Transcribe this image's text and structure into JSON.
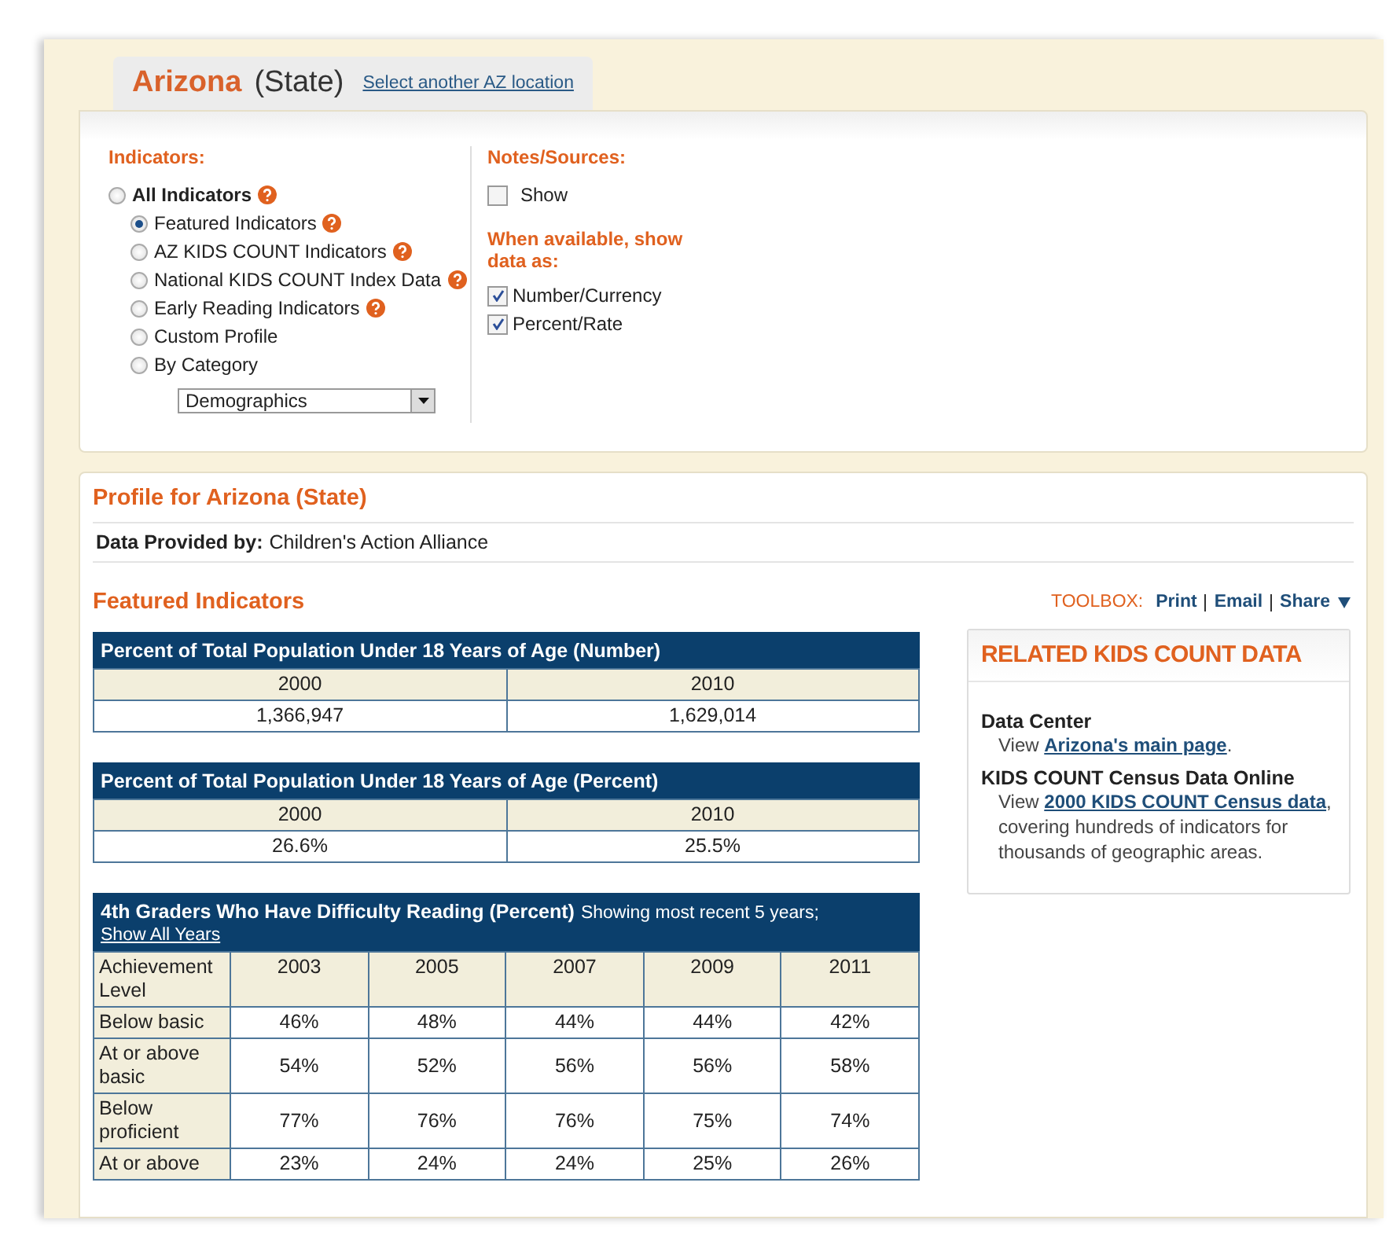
{
  "location_tab": {
    "name": "Arizona",
    "type": "(State)",
    "link": "Select another AZ location"
  },
  "options": {
    "indicators_label": "Indicators:",
    "indicators": [
      {
        "label": "All Indicators",
        "selected": false,
        "help": true,
        "children": [
          {
            "label": "Featured Indicators",
            "selected": true,
            "help": true
          },
          {
            "label": "AZ KIDS COUNT Indicators",
            "selected": false,
            "help": true
          },
          {
            "label": "National KIDS COUNT Index Data",
            "selected": false,
            "help": true
          },
          {
            "label": "Early Reading Indicators",
            "selected": false,
            "help": true
          },
          {
            "label": "Custom Profile",
            "selected": false,
            "help": false
          },
          {
            "label": "By Category",
            "selected": false,
            "help": false
          }
        ]
      }
    ],
    "category_select": {
      "value": "Demographics"
    },
    "notes_label": "Notes/Sources:",
    "notes_show": {
      "label": "Show",
      "checked": false
    },
    "display_label": "When available, show data as:",
    "display_options": [
      {
        "label": "Number/Currency",
        "checked": true
      },
      {
        "label": "Percent/Rate",
        "checked": true
      }
    ]
  },
  "profile": {
    "title": "Profile for Arizona (State)",
    "provider_label": "Data Provided by:",
    "provider": "Children's Action Alliance",
    "section_title": "Featured Indicators",
    "toolbox": {
      "label": "TOOLBOX:",
      "links": [
        "Print",
        "Email",
        "Share"
      ]
    },
    "tables": [
      {
        "title": "Percent of Total Population Under 18 Years of Age (Number)",
        "columns": [
          "2000",
          "2010"
        ],
        "rows": [
          [
            "1,366,947",
            "1,629,014"
          ]
        ]
      },
      {
        "title": "Percent of Total Population Under 18 Years of Age (Percent)",
        "columns": [
          "2000",
          "2010"
        ],
        "rows": [
          [
            "26.6%",
            "25.5%"
          ]
        ]
      },
      {
        "title": "4th Graders Who Have Difficulty Reading (Percent)",
        "note": "Showing most recent 5 years;",
        "link": "Show All Years",
        "columns": [
          "Achievement Level",
          "2003",
          "2005",
          "2007",
          "2009",
          "2011"
        ],
        "rows": [
          [
            "Below basic",
            "46%",
            "48%",
            "44%",
            "44%",
            "42%"
          ],
          [
            "At or above basic",
            "54%",
            "52%",
            "56%",
            "56%",
            "58%"
          ],
          [
            "Below proficient",
            "77%",
            "76%",
            "76%",
            "75%",
            "74%"
          ],
          [
            "At or above",
            "23%",
            "24%",
            "24%",
            "25%",
            "26%"
          ]
        ]
      }
    ]
  },
  "related": {
    "title": "RELATED KIDS COUNT DATA",
    "sections": [
      {
        "heading": "Data Center",
        "prefix": "View",
        "link": "Arizona's main page",
        "suffix": "."
      },
      {
        "heading": "KIDS COUNT Census Data Online",
        "prefix": "View",
        "link": "2000 KIDS COUNT Census data",
        "suffix": ", covering hundreds of indicators for thousands of geographic areas."
      }
    ]
  }
}
